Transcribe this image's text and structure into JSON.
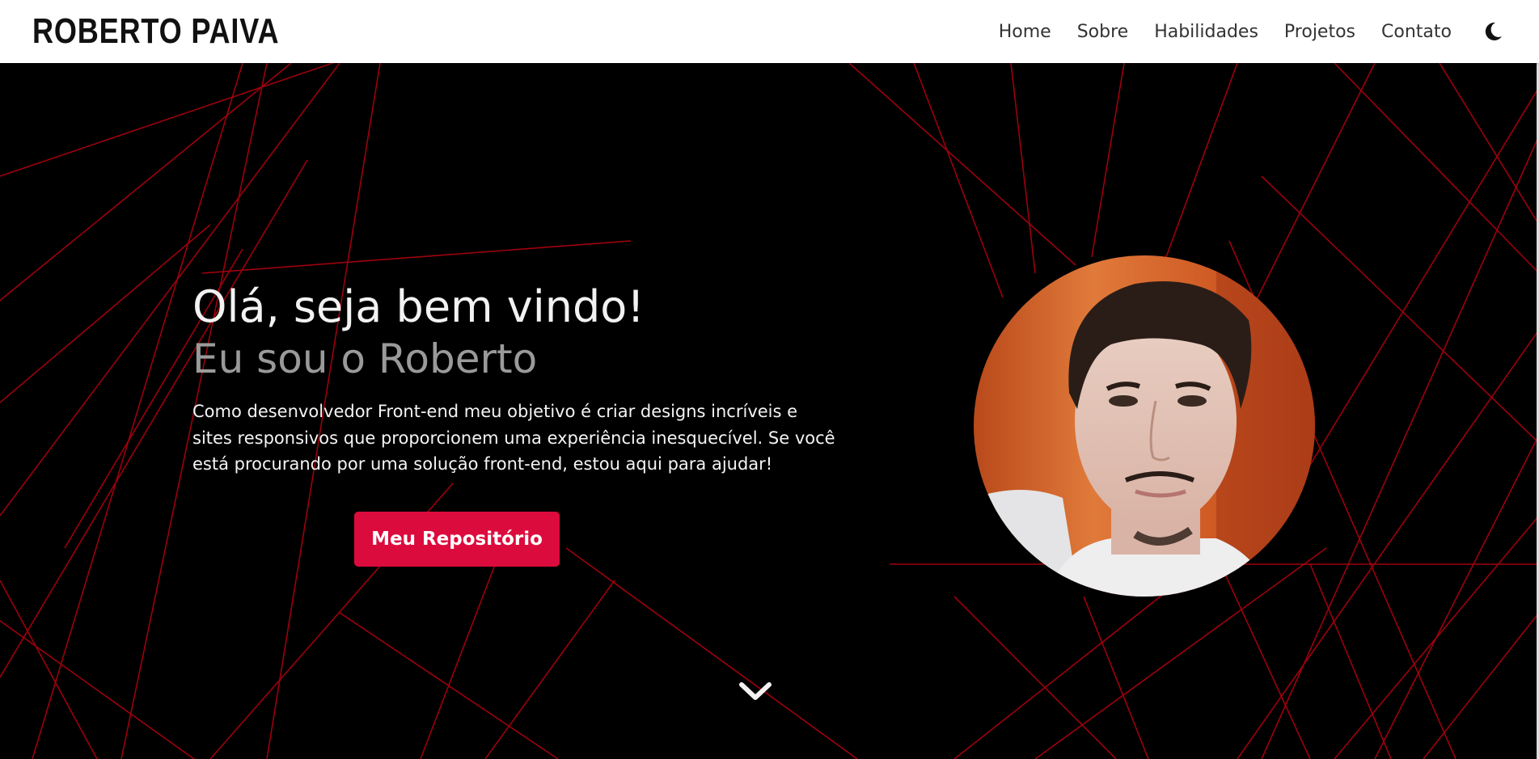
{
  "brand": {
    "name": "ROBERTO PAIVA"
  },
  "nav": {
    "items": [
      {
        "label": "Home"
      },
      {
        "label": "Sobre"
      },
      {
        "label": "Habilidades"
      },
      {
        "label": "Projetos"
      },
      {
        "label": "Contato"
      }
    ],
    "theme_toggle_icon": "moon-icon"
  },
  "hero": {
    "title": "Olá, seja bem vindo!",
    "subtitle": "Eu sou o Roberto",
    "description": "Como desenvolvedor Front-end meu objetivo é criar designs incríveis e sites responsivos que proporcionem uma experiência inesquecível. Se você está procurando por uma solução front-end, estou aqui para ajudar!",
    "button_label": "Meu Repositório",
    "avatar_icon": "profile-photo",
    "scroll_icon": "chevron-down-icon"
  },
  "colors": {
    "accent": "#dc0b3d",
    "background": "#000000",
    "navbar": "#ffffff",
    "lines": "#b3000f"
  }
}
